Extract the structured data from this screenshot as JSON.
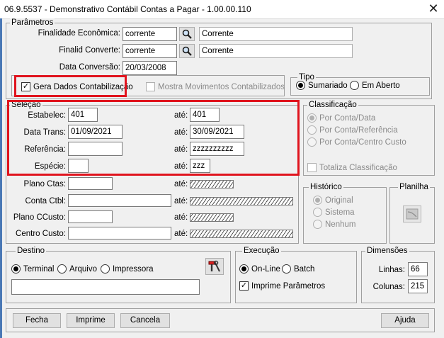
{
  "window": {
    "title": "06.9.5537 - Demonstrativo Contábil Contas a Pagar - 1.00.00.110",
    "close_glyph": "✕"
  },
  "parametros": {
    "group_label": "Parâmetros",
    "finalidade_label": "Finalidade Econômica:",
    "finalidade_value": "corrente",
    "finalidade_desc": "Corrente",
    "finalid_conv_label": "Finalid Converte:",
    "finalid_conv_value": "corrente",
    "finalid_conv_desc": "Corrente",
    "data_conv_label": "Data Conversão:",
    "data_conv_value": "20/03/2008",
    "gera_dados_label": "Gera Dados Contabilização",
    "gera_dados_checked": true,
    "mostra_mov_label": "Mostra Movimentos Contabilizados",
    "mostra_mov_checked": false
  },
  "tipo": {
    "group_label": "Tipo",
    "options": [
      {
        "label": "Sumariado",
        "selected": true
      },
      {
        "label": "Em Aberto",
        "selected": false
      }
    ]
  },
  "selecao": {
    "group_label": "Seleção",
    "ate_label": "até:",
    "estabelec_label": "Estabelec:",
    "estabelec_from": "401",
    "estabelec_to": "401",
    "data_trans_label": "Data Trans:",
    "data_trans_from": "01/09/2021",
    "data_trans_to": "30/09/2021",
    "referencia_label": "Referência:",
    "referencia_from": "",
    "referencia_to": "zzzzzzzzzz",
    "especie_label": "Espécie:",
    "especie_from": "",
    "especie_to": "zzz",
    "plano_ctas_label": "Plano Ctas:",
    "conta_ctbl_label": "Conta Ctbl:",
    "plano_ccusto_label": "Plano CCusto:",
    "centro_custo_label": "Centro Custo:"
  },
  "classificacao": {
    "group_label": "Classificação",
    "options": [
      {
        "label": "Por Conta/Data",
        "selected": true
      },
      {
        "label": "Por Conta/Referência",
        "selected": false
      },
      {
        "label": "Por Conta/Centro Custo",
        "selected": false
      }
    ],
    "totaliza_label": "Totaliza Classificação"
  },
  "historico": {
    "group_label": "Histórico",
    "options": [
      {
        "label": "Original",
        "selected": true
      },
      {
        "label": "Sistema",
        "selected": false
      },
      {
        "label": "Nenhum",
        "selected": false
      }
    ]
  },
  "planilha": {
    "group_label": "Planilha"
  },
  "destino": {
    "group_label": "Destino",
    "options": [
      {
        "label": "Terminal",
        "selected": true
      },
      {
        "label": "Arquivo",
        "selected": false
      },
      {
        "label": "Impressora",
        "selected": false
      }
    ],
    "path_value": ""
  },
  "execucao": {
    "group_label": "Execução",
    "options": [
      {
        "label": "On-Line",
        "selected": true
      },
      {
        "label": "Batch",
        "selected": false
      }
    ],
    "imprime_label": "Imprime Parâmetros",
    "imprime_checked": true
  },
  "dimensoes": {
    "group_label": "Dimensões",
    "linhas_label": "Linhas:",
    "linhas_value": "66",
    "colunas_label": "Colunas:",
    "colunas_value": "215"
  },
  "buttons": {
    "fecha": "Fecha",
    "imprime": "Imprime",
    "cancela": "Cancela",
    "ajuda": "Ajuda"
  },
  "colors": {
    "highlight_red": "#e0141e",
    "window_bg": "#f0f0f0"
  }
}
